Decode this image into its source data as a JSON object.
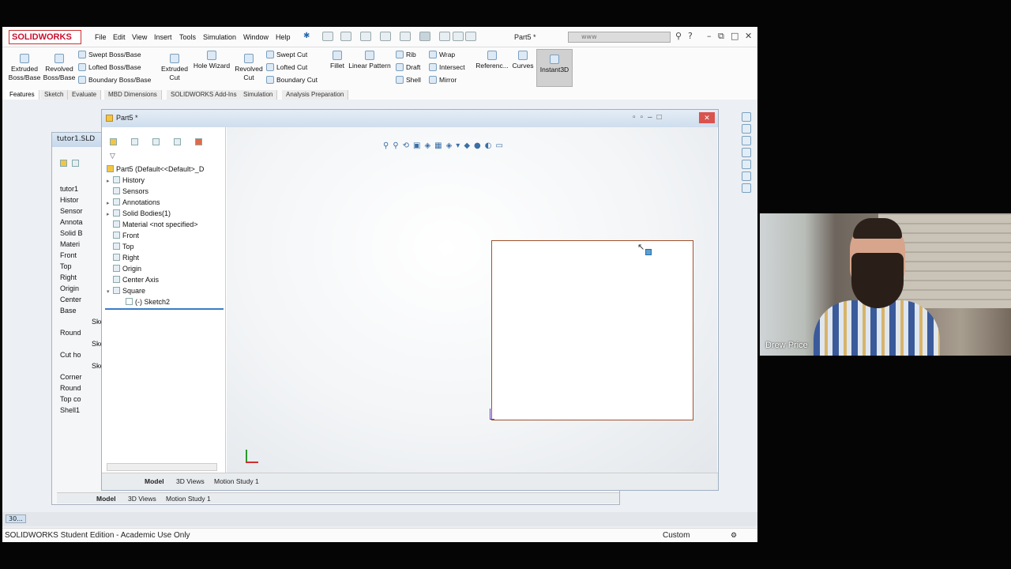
{
  "app": {
    "logo": "SOLIDWORKS",
    "doc_title": "Part5 *",
    "search_text": "www"
  },
  "menu": [
    "File",
    "Edit",
    "View",
    "Insert",
    "Tools",
    "Simulation",
    "Window",
    "Help"
  ],
  "ribbon": {
    "extruded_boss": "Extruded Boss/Base",
    "revolved_boss": "Revolved Boss/Base",
    "swept_boss": "Swept Boss/Base",
    "lofted_boss": "Lofted Boss/Base",
    "boundary_boss": "Boundary Boss/Base",
    "extruded_cut": "Extruded Cut",
    "hole_wizard": "Hole Wizard",
    "revolved_cut": "Revolved Cut",
    "swept_cut": "Swept Cut",
    "lofted_cut": "Lofted Cut",
    "boundary_cut": "Boundary Cut",
    "fillet": "Fillet",
    "linear_pattern": "Linear Pattern",
    "rib": "Rib",
    "draft": "Draft",
    "shell": "Shell",
    "wrap": "Wrap",
    "intersect": "Intersect",
    "mirror": "Mirror",
    "reference": "Referenc...",
    "curves": "Curves",
    "instant3d": "Instant3D"
  },
  "command_tabs": [
    "Features",
    "Sketch",
    "Evaluate",
    "MBD Dimensions",
    "SOLIDWORKS Add-Ins",
    "Simulation",
    "Analysis Preparation"
  ],
  "back_window": {
    "title": "tutor1.SLD",
    "tree": [
      "tutor1",
      "Histor",
      "Sensor",
      "Annota",
      "Solid B",
      "Materi",
      "Front",
      "Top",
      "Right",
      "Origin",
      "Center",
      "Base",
      "Ske",
      "Round",
      "Ske",
      "Cut ho",
      "Ske",
      "Corner",
      "Round",
      "Top co",
      "Shell1"
    ],
    "tabs": [
      "Model",
      "3D Views",
      "Motion Study 1"
    ]
  },
  "front_window": {
    "title": "Part5 *",
    "tree": {
      "root": "Part5  (Default<<Default>_D",
      "items": [
        "History",
        "Sensors",
        "Annotations",
        "Solid Bodies(1)",
        "Material <not specified>",
        "Front",
        "Top",
        "Right",
        "Origin",
        "Center Axis",
        "Square"
      ],
      "child": "(-) Sketch2"
    },
    "tabs": [
      "Model",
      "3D Views",
      "Motion Study 1"
    ]
  },
  "taskbar": {
    "item": "30..."
  },
  "status": {
    "left": "SOLIDWORKS Student Edition - Academic Use Only",
    "right": "Custom"
  },
  "webcam": {
    "name": "Drew Price"
  }
}
